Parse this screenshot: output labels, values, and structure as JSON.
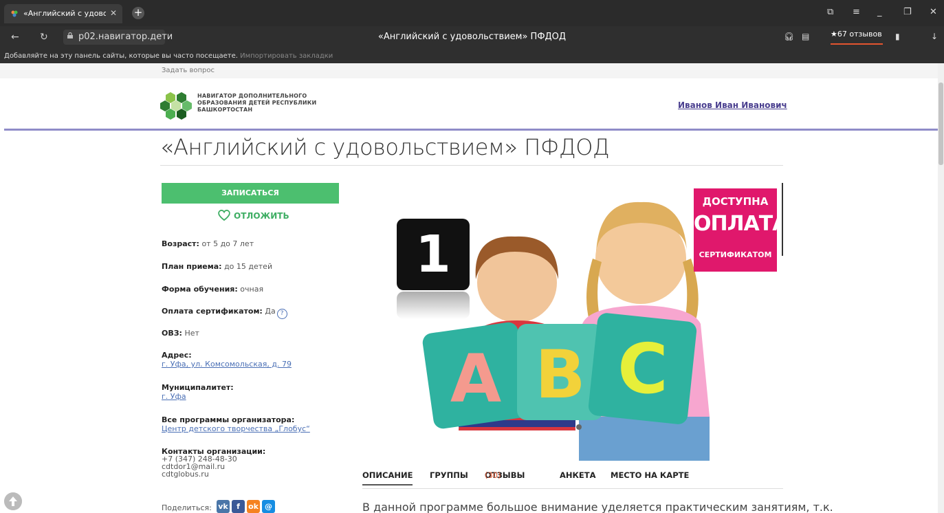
{
  "browser": {
    "tab_title": "«Английский с удовольствием» ПФДОД",
    "url": "p02.навигатор.дети",
    "page_title": "«Английский с удовольствием» ПФДОД",
    "reviews": "★67 отзывов",
    "bookmarks_hint": "Добавляйте на эту панель сайты, которые вы часто посещаете.",
    "bookmarks_import": "Импортировать закладки"
  },
  "header": {
    "ask": "Задать вопрос",
    "logo_text": "НАВИГАТОР ДОПОЛНИТЕЛЬНОГО ОБРАЗОВАНИЯ ДЕТЕЙ РЕСПУБЛИКИ БАШКОРТОСТАН",
    "user": "Иванов Иван Иванович"
  },
  "program": {
    "title": "«Английский с удовольствием» ПФДОД",
    "signup": "ЗАПИСАТЬСЯ",
    "postpone": "ОТЛОЖИТЬ",
    "age_label": "Возраст:",
    "age": "от 5 до 7 лет",
    "plan_label": "План приема:",
    "plan": "до 15 детей",
    "form_label": "Форма обучения:",
    "form": "очная",
    "cert_label": "Оплата сертификатом:",
    "cert": "Да",
    "ovz_label": "ОВЗ:",
    "ovz": "Нет",
    "address_label": "Адрес:",
    "address": "г. Уфа, ул. Комсомольская, д. 79",
    "municipality_label": "Муниципалитет:",
    "municipality": "г. Уфа",
    "all_programs_label": "Все программы организатора:",
    "all_programs": "Центр детского творчества „Глобус“",
    "contacts_label": "Контакты организации:",
    "phone": "+7 (347) 248-48-30",
    "email": "cdtdor1@mail.ru",
    "site": "cdtglobus.ru",
    "share_label": "Поделиться:"
  },
  "hero": {
    "promo_line1": "ДОСТУПНА",
    "promo_line2": "ОПЛАТА",
    "promo_line3": "СЕРТИФИКАТОМ",
    "number": "1",
    "letters": [
      "A",
      "B",
      "C"
    ]
  },
  "tabs": [
    {
      "label": "ОПИСАНИЕ"
    },
    {
      "label": "ГРУППЫ"
    },
    {
      "label": "ОТЗЫВЫ",
      "count": "(30)"
    },
    {
      "label": "АНКЕТА"
    },
    {
      "label": "МЕСТО НА КАРТЕ"
    }
  ],
  "description": "В данной программе большое внимание уделяется практическим занятиям, т.к.",
  "social": [
    {
      "name": "vk",
      "label": "vk",
      "color": "#4a76a8"
    },
    {
      "name": "facebook",
      "label": "f",
      "color": "#3b5998"
    },
    {
      "name": "odnoklassniki",
      "label": "ok",
      "color": "#f58220"
    },
    {
      "name": "moimir",
      "label": "@",
      "color": "#168de2"
    }
  ],
  "colors": {
    "accent_green": "#4cbf6f",
    "promo_pink": "#e0186c",
    "divider": "#8f8cc8",
    "user_link": "#4a3f8f"
  }
}
